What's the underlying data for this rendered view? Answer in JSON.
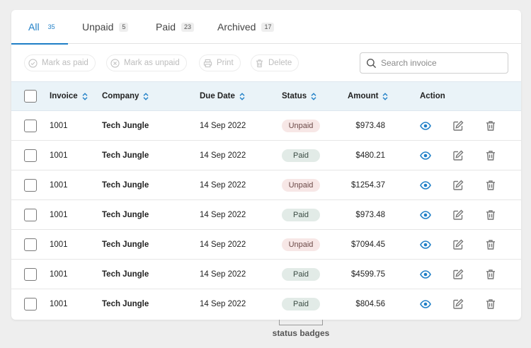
{
  "tabs": [
    {
      "label": "All",
      "count": "35",
      "active": true
    },
    {
      "label": "Unpaid",
      "count": "5"
    },
    {
      "label": "Paid",
      "count": "23"
    },
    {
      "label": "Archived",
      "count": "17"
    }
  ],
  "toolbar": {
    "mark_paid": "Mark as paid",
    "mark_unpaid": "Mark as unpaid",
    "print": "Print",
    "delete": "Delete",
    "search_placeholder": "Search invoice"
  },
  "table": {
    "columns": {
      "invoice": "Invoice",
      "company": "Company",
      "due_date": "Due Date",
      "status": "Status",
      "amount": "Amount",
      "action": "Action"
    },
    "rows": [
      {
        "invoice": "1001",
        "company": "Tech Jungle",
        "due_date": "14 Sep 2022",
        "status": "Unpaid",
        "amount": "$973.48"
      },
      {
        "invoice": "1001",
        "company": "Tech Jungle",
        "due_date": "14 Sep 2022",
        "status": "Paid",
        "amount": "$480.21"
      },
      {
        "invoice": "1001",
        "company": "Tech Jungle",
        "due_date": "14 Sep 2022",
        "status": "Unpaid",
        "amount": "$1254.37"
      },
      {
        "invoice": "1001",
        "company": "Tech Jungle",
        "due_date": "14 Sep 2022",
        "status": "Paid",
        "amount": "$973.48"
      },
      {
        "invoice": "1001",
        "company": "Tech Jungle",
        "due_date": "14 Sep 2022",
        "status": "Unpaid",
        "amount": "$7094.45"
      },
      {
        "invoice": "1001",
        "company": "Tech Jungle",
        "due_date": "14 Sep 2022",
        "status": "Paid",
        "amount": "$4599.75"
      },
      {
        "invoice": "1001",
        "company": "Tech Jungle",
        "due_date": "14 Sep 2022",
        "status": "Paid",
        "amount": "$804.56"
      }
    ]
  },
  "icons": {
    "check_circle": "check-circle-icon",
    "x_circle": "x-circle-icon",
    "printer": "printer-icon",
    "trash": "trash-icon",
    "search": "search-icon",
    "sort": "sort-icon",
    "eye": "eye-icon",
    "edit": "edit-icon"
  },
  "colors": {
    "accent": "#1f7fc7",
    "header_bg": "#eaf3f8",
    "unpaid_bg": "#f7e7e6",
    "paid_bg": "#e2ebe7"
  },
  "annotation": "status badges"
}
